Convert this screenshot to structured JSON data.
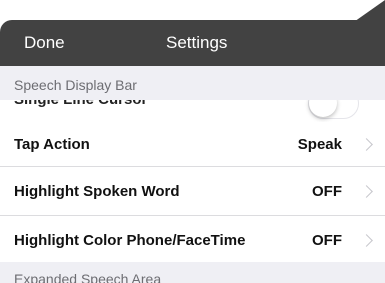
{
  "navbar": {
    "done_label": "Done",
    "title": "Settings"
  },
  "sections": [
    {
      "header": "Speech Display Bar",
      "rows": [
        {
          "label": "Single Line Cursor",
          "type": "toggle",
          "toggle_on": false
        },
        {
          "label": "Tap Action",
          "value": "Speak",
          "type": "disclosure"
        },
        {
          "label": "Highlight Spoken Word",
          "value": "OFF",
          "type": "disclosure"
        },
        {
          "label": "Highlight Color Phone/FaceTime",
          "value": "OFF",
          "type": "disclosure"
        }
      ]
    },
    {
      "header": "Expanded Speech Area"
    }
  ],
  "colors": {
    "navbar_bg": "#424242",
    "group_bg": "#efeff4",
    "chevron": "#c7c7cc"
  }
}
